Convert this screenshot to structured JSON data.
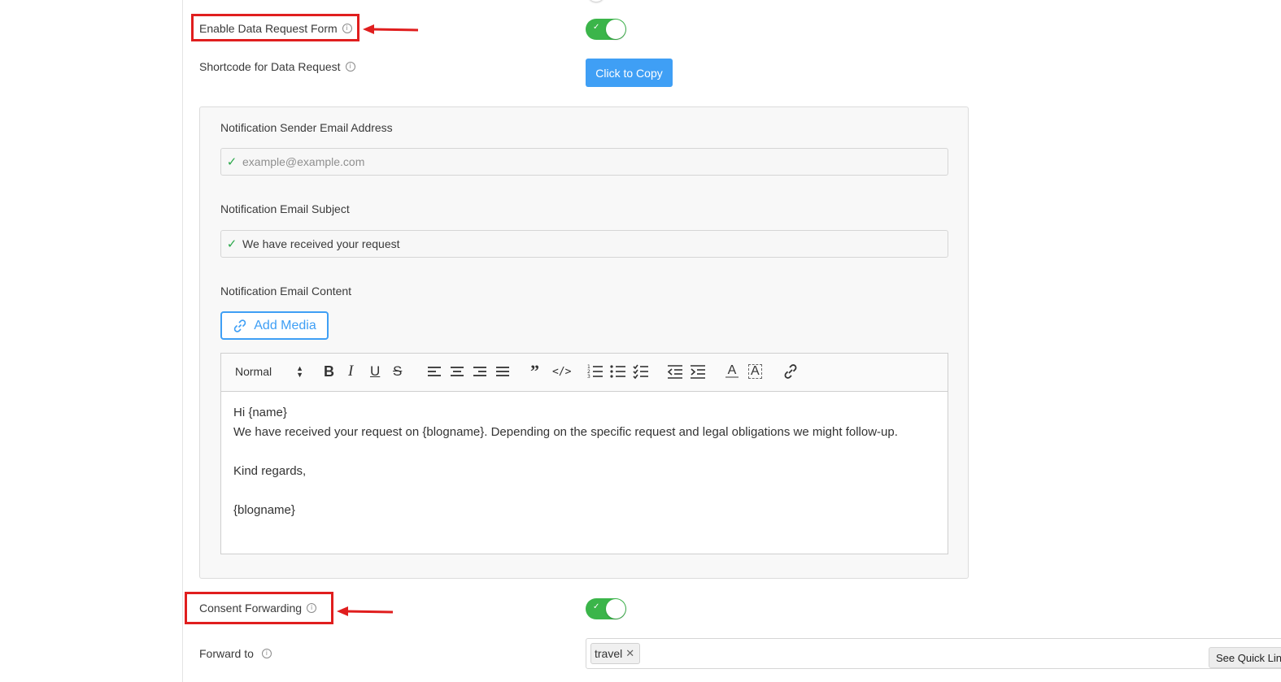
{
  "settings": {
    "enable_form": {
      "label": "Enable Data Request Form",
      "enabled": true
    },
    "shortcode": {
      "label": "Shortcode for Data Request",
      "button": "Click to Copy"
    },
    "notification": {
      "sender_label": "Notification Sender Email Address",
      "sender_placeholder": "example@example.com",
      "subject_label": "Notification Email Subject",
      "subject_value": "We have received your request",
      "content_label": "Notification Email Content",
      "add_media": "Add Media",
      "format_select": "Normal",
      "body": {
        "line1": "Hi {name}",
        "line2": "We have received your request on {blogname}. Depending on the specific request and legal obligations we might follow-up.",
        "line3": "Kind regards,",
        "line4": "{blogname}"
      }
    },
    "consent_forwarding": {
      "label": "Consent Forwarding",
      "enabled": true
    },
    "forward_to": {
      "label": "Forward to",
      "tags": [
        "travel"
      ],
      "quick_link": "See Quick Lin"
    }
  },
  "colors": {
    "accent": "#3f9ff5",
    "toggle_on": "#3bb54a",
    "highlight": "#e01e1e",
    "valid_check": "#2aa84a"
  }
}
